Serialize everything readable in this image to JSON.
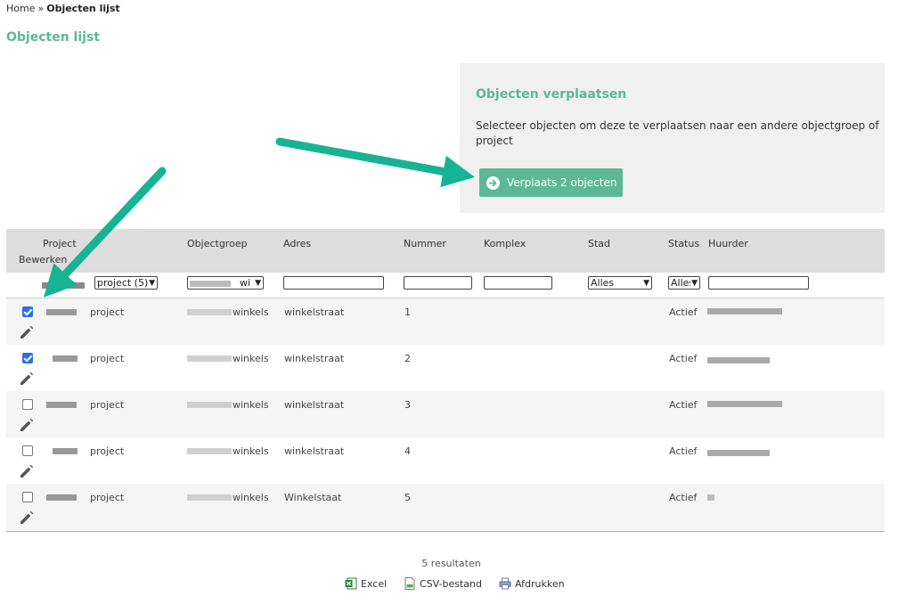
{
  "breadcrumb": {
    "home": "Home",
    "separator": "»",
    "current": "Objecten lijst"
  },
  "page_title": "Objecten lijst",
  "move_panel": {
    "title": "Objecten verplaatsen",
    "description": "Selecteer objecten om deze te verplaatsen naar een andere objectgroep of project",
    "button_label": "Verplaats 2 objecten",
    "button_icon": "arrow-right-circle-icon"
  },
  "table": {
    "headers": {
      "project": "Project",
      "bewerken": "Bewerken",
      "objectgroep": "Objectgroep",
      "adres": "Adres",
      "nummer": "Nummer",
      "komplex": "Komplex",
      "stad": "Stad",
      "status": "Status",
      "huurder": "Huurder"
    },
    "filters": {
      "project_select": "project (5)",
      "objectgroep_select": "wi",
      "adres_value": "",
      "nummer_value": "",
      "komplex_value": "",
      "stad_select": "Alles",
      "status_select": "Alles",
      "huurder_value": ""
    },
    "rows": [
      {
        "checked": true,
        "project": "project",
        "objectgroep": "winkels",
        "adres": "winkelstraat",
        "nummer": "1",
        "komplex": "",
        "stad": "",
        "status": "Actief"
      },
      {
        "checked": true,
        "project": "project",
        "objectgroep": "winkels",
        "adres": "winkelstraat",
        "nummer": "2",
        "komplex": "",
        "stad": "",
        "status": "Actief"
      },
      {
        "checked": false,
        "project": "project",
        "objectgroep": "winkels",
        "adres": "winkelstraat",
        "nummer": "3",
        "komplex": "",
        "stad": "",
        "status": "Actief"
      },
      {
        "checked": false,
        "project": "project",
        "objectgroep": "winkels",
        "adres": "winkelstraat",
        "nummer": "4",
        "komplex": "",
        "stad": "",
        "status": "Actief"
      },
      {
        "checked": false,
        "project": "project",
        "objectgroep": "winkels",
        "adres": "Winkelstaat",
        "nummer": "5",
        "komplex": "",
        "stad": "",
        "status": "Actief"
      }
    ]
  },
  "results_text": "5 resultaten",
  "exports": {
    "excel": "Excel",
    "csv": "CSV-bestand",
    "print": "Afdrukken"
  },
  "colors": {
    "accent": "#5cb896",
    "annotation_arrow": "#16b394",
    "checkbox_checked": "#2f6fe4"
  }
}
